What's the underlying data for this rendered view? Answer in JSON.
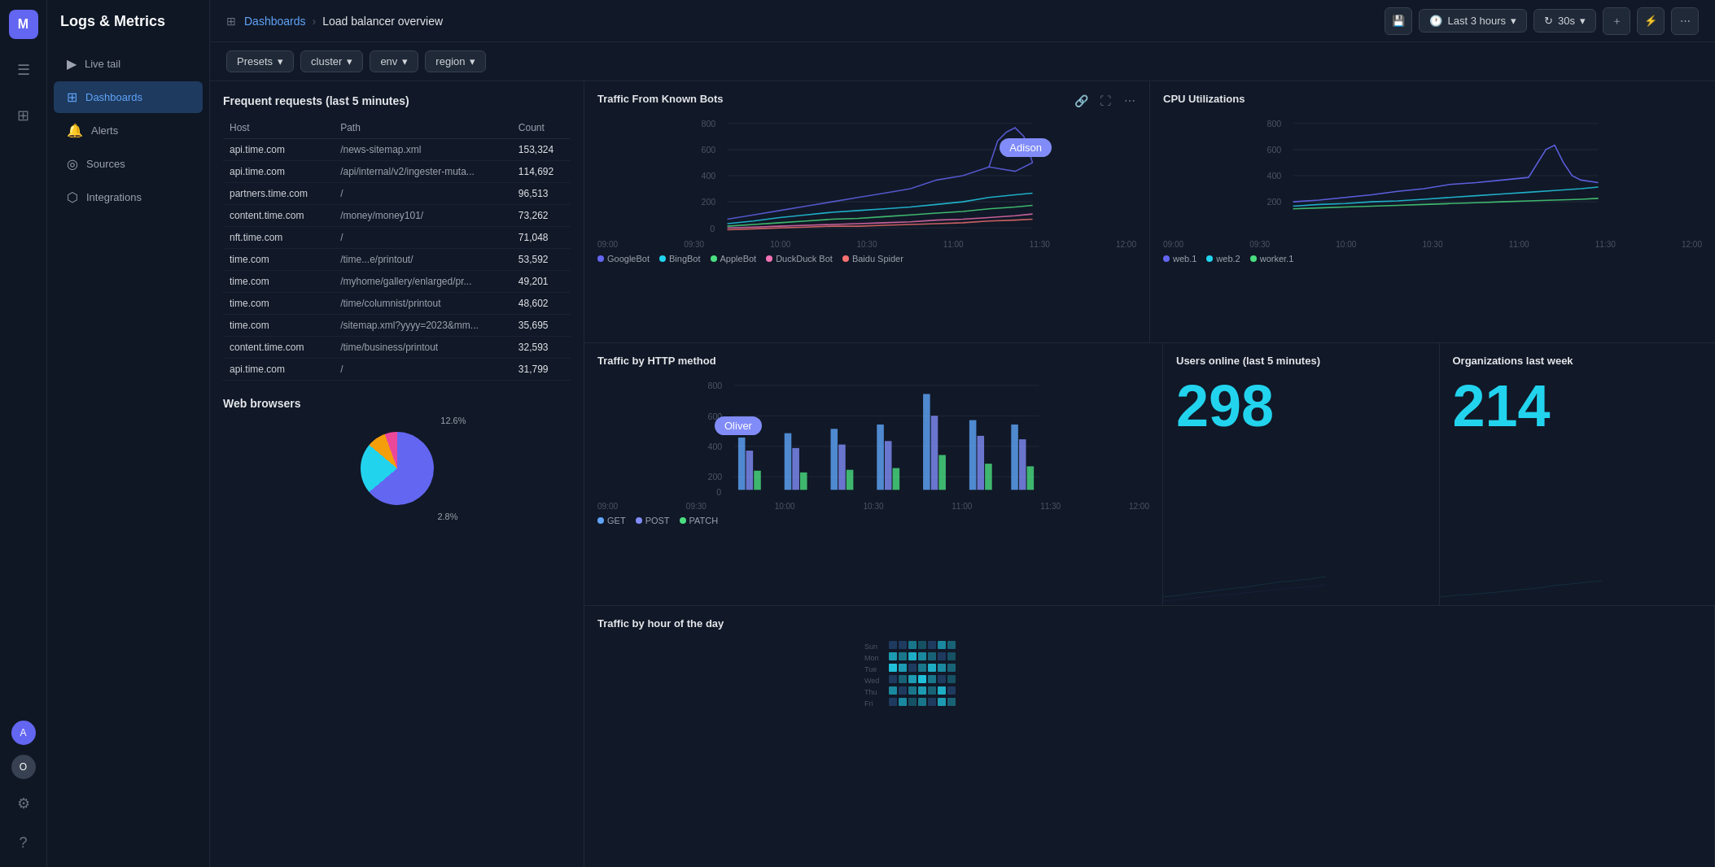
{
  "app": {
    "title": "Logs & Metrics",
    "logo_text": "M"
  },
  "sidebar": {
    "icons": [
      "☰",
      "📊",
      "🔔",
      "⚡",
      "🔧"
    ]
  },
  "nav": {
    "items": [
      {
        "label": "Live tail",
        "icon": "▶",
        "active": false
      },
      {
        "label": "Dashboards",
        "icon": "⊞",
        "active": true
      },
      {
        "label": "Alerts",
        "icon": "🔔",
        "active": false
      },
      {
        "label": "Sources",
        "icon": "◎",
        "active": false
      },
      {
        "label": "Integrations",
        "icon": "⬡",
        "active": false
      }
    ]
  },
  "topbar": {
    "breadcrumb_link": "Dashboards",
    "breadcrumb_sep": "›",
    "breadcrumb_current": "Load balancer overview",
    "time_label": "Last 3 hours",
    "refresh_label": "30s"
  },
  "filters": {
    "presets": "Presets",
    "cluster": "cluster",
    "env": "env",
    "region": "region"
  },
  "frequent_requests": {
    "title": "Frequent requests (last 5 minutes)",
    "columns": [
      "Host",
      "Path",
      "Count"
    ],
    "rows": [
      {
        "host": "api.time.com",
        "path": "/news-sitemap.xml",
        "count": "153,324"
      },
      {
        "host": "api.time.com",
        "path": "/api/internal/v2/ingester-muta...",
        "count": "114,692"
      },
      {
        "host": "partners.time.com",
        "path": "/",
        "count": "96,513"
      },
      {
        "host": "content.time.com",
        "path": "/money/money101/",
        "count": "73,262"
      },
      {
        "host": "nft.time.com",
        "path": "/",
        "count": "71,048"
      },
      {
        "host": "time.com",
        "path": "/time...e/printout/",
        "count": "53,592"
      },
      {
        "host": "time.com",
        "path": "/myhome/gallery/enlarged/pr...",
        "count": "49,201"
      },
      {
        "host": "time.com",
        "path": "/time/columnist/printout",
        "count": "48,602"
      },
      {
        "host": "time.com",
        "path": "/sitemap.xml?yyyy=2023&mm...",
        "count": "35,695"
      },
      {
        "host": "content.time.com",
        "path": "/time/business/printout",
        "count": "32,593"
      },
      {
        "host": "api.time.com",
        "path": "/",
        "count": "31,799"
      }
    ]
  },
  "browsers": {
    "title": "Web browsers",
    "labels": [
      "12.6%",
      "2.8%"
    ]
  },
  "traffic_bots": {
    "title": "Traffic From Known Bots",
    "y_labels": [
      "800",
      "600",
      "400",
      "200",
      "0"
    ],
    "x_labels": [
      "09:00",
      "09:30",
      "10:00",
      "10:30",
      "11:00",
      "11:30",
      "12:00"
    ],
    "legend": [
      {
        "label": "GoogleBot",
        "color": "#6366f1"
      },
      {
        "label": "BingBot",
        "color": "#22d3ee"
      },
      {
        "label": "AppleBot",
        "color": "#4ade80"
      },
      {
        "label": "DuckDuck Bot",
        "color": "#f472b6"
      },
      {
        "label": "Baidu Spider",
        "color": "#f87171"
      }
    ],
    "tooltip": "Adison"
  },
  "cpu_utilizations": {
    "title": "CPU Utilizations",
    "y_labels": [
      "800",
      "600",
      "400",
      "200"
    ],
    "x_labels": [
      "09:00",
      "09:30",
      "10:00",
      "10:30",
      "11:00",
      "11:30",
      "12:00"
    ],
    "legend": [
      {
        "label": "web.1",
        "color": "#6366f1"
      },
      {
        "label": "web.2",
        "color": "#22d3ee"
      },
      {
        "label": "worker.1",
        "color": "#4ade80"
      }
    ]
  },
  "traffic_http": {
    "title": "Traffic by HTTP method",
    "y_labels": [
      "800",
      "600",
      "400",
      "200",
      "0"
    ],
    "x_labels": [
      "09:00",
      "09:30",
      "10:00",
      "10:30",
      "11:00",
      "11:30",
      "12:00"
    ],
    "legend": [
      {
        "label": "GET",
        "color": "#60a5fa"
      },
      {
        "label": "POST",
        "color": "#818cf8"
      },
      {
        "label": "PATCH",
        "color": "#4ade80"
      }
    ],
    "tooltip": "Oliver"
  },
  "users_online": {
    "title": "Users online (last 5 minutes)",
    "value": "298"
  },
  "organizations": {
    "title": "Organizations last week",
    "value": "214"
  },
  "traffic_day": {
    "title": "Traffic by hour of the day"
  }
}
